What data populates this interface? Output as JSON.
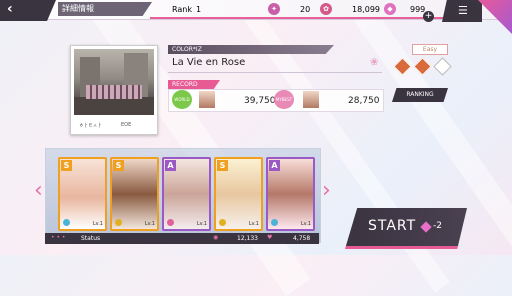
{
  "header": {
    "back_icon": "back-arrow-icon",
    "title": "詳細情報",
    "rank_label": "Rank",
    "rank_value": "1",
    "stat1_value": "20",
    "stat2_value": "18,099",
    "stat3_value": "999",
    "plus_icon": "plus-icon",
    "menu_icon": "menu-icon"
  },
  "album": {
    "caption_left": "ㅎㅏㅌㅅㅏ",
    "caption_right": "EOE"
  },
  "song": {
    "group": "COLOR*IZ",
    "title": "La Vie en Rose"
  },
  "record": {
    "label": "RECORD",
    "world_label": "WORLD",
    "world_score": "39,750",
    "mybest_label": "MYBEST",
    "mybest_score": "28,750"
  },
  "difficulty": {
    "label": "Easy",
    "colors": [
      "#d86a3c",
      "#d86a3c",
      "#ffffff"
    ]
  },
  "ranking_label": "RANKING",
  "team": {
    "cards": [
      {
        "rank": "S",
        "level": "Lv.1",
        "badge_color": "#f0a020"
      },
      {
        "rank": "S",
        "level": "Lv.1",
        "badge_color": "#f0a020"
      },
      {
        "rank": "A",
        "level": "Lv.1",
        "badge_color": "#9b59c6"
      },
      {
        "rank": "S",
        "level": "Lv.1",
        "badge_color": "#f0a020"
      },
      {
        "rank": "A",
        "level": "Lv.1",
        "badge_color": "#9b59c6"
      }
    ],
    "status_label": "Status",
    "stat_a": "12,133",
    "stat_b": "4,758"
  },
  "start": {
    "label": "START",
    "cost": "-2"
  }
}
